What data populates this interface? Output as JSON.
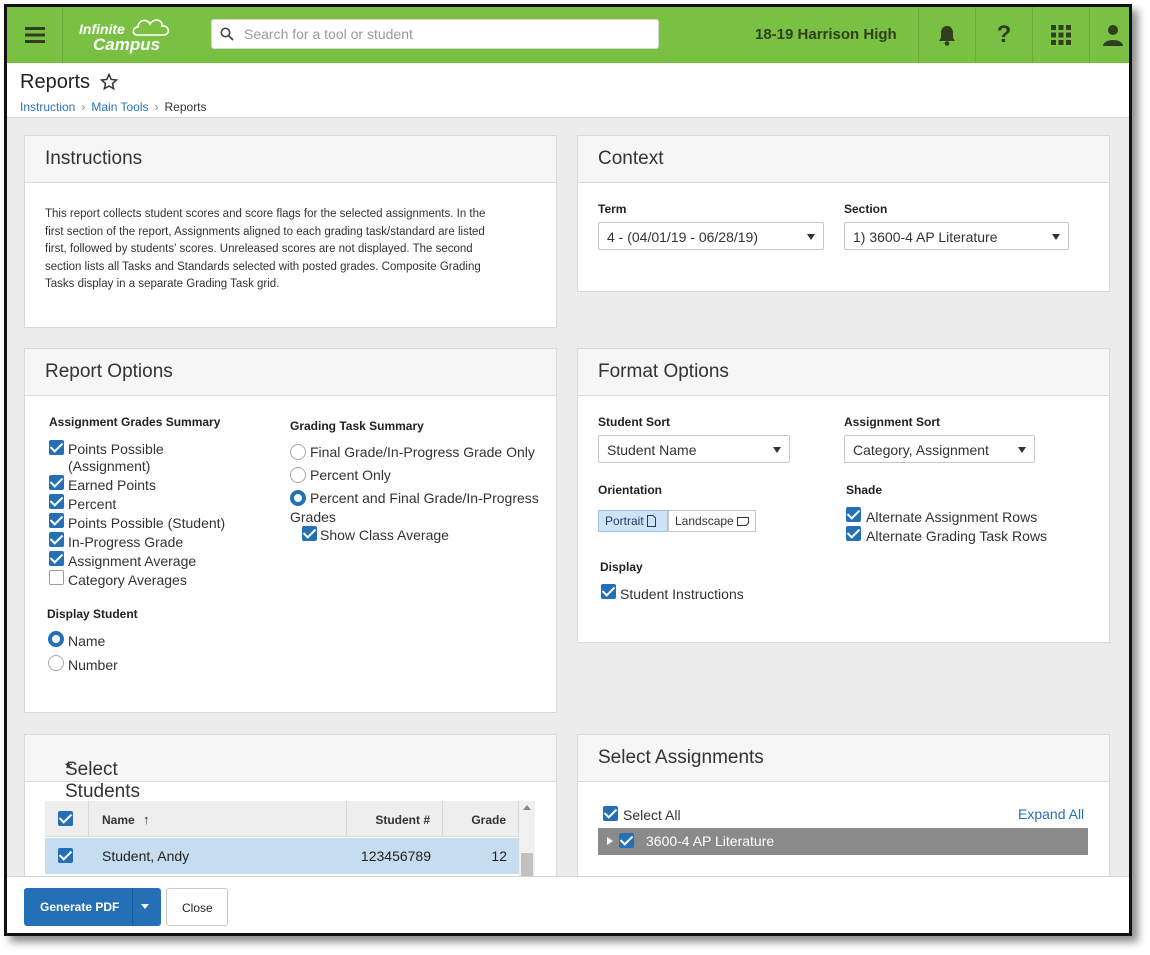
{
  "header": {
    "logo_line1": "Infinite",
    "logo_line2": "Campus",
    "search_placeholder": "Search for a tool or student",
    "school": "18-19 Harrison High",
    "icons": [
      "menu-icon",
      "bell-icon",
      "help-icon",
      "apps-grid-icon",
      "user-icon"
    ]
  },
  "page": {
    "title": "Reports",
    "breadcrumbs": [
      "Instruction",
      "Main Tools",
      "Reports"
    ]
  },
  "instructions": {
    "title": "Instructions",
    "text": "This report collects student scores and score flags for the selected assignments. In the first section of the report, Assignments aligned to each grading task/standard are listed first, followed by students' scores. Unreleased scores are not displayed. The second section lists all Tasks and Standards selected with posted grades. Composite Grading Tasks display in a separate Grading Task grid."
  },
  "context": {
    "title": "Context",
    "term_label": "Term",
    "term_value": "4 - (04/01/19 - 06/28/19)",
    "section_label": "Section",
    "section_value": "1) 3600-4 AP Literature"
  },
  "report_options": {
    "title": "Report Options",
    "ags_label": "Assignment Grades Summary",
    "ags_items": [
      {
        "label": "Points Possible (Assignment)",
        "checked": true
      },
      {
        "label": "Earned Points",
        "checked": true
      },
      {
        "label": "Percent",
        "checked": true
      },
      {
        "label": "Points Possible (Student)",
        "checked": true
      },
      {
        "label": "In-Progress Grade",
        "checked": true
      },
      {
        "label": "Assignment Average",
        "checked": true
      },
      {
        "label": "Category Averages",
        "checked": false
      }
    ],
    "ags_pp_line1": "Points Possible",
    "ags_pp_line2": "(Assignment)",
    "gts_label": "Grading Task Summary",
    "gts_items": [
      {
        "label": "Final Grade/In-Progress Grade Only",
        "selected": false
      },
      {
        "label": "Percent Only",
        "selected": false
      },
      {
        "label": "Percent and Final Grade/In-Progress Grades",
        "selected": true
      }
    ],
    "gts_pfg_line1": "Percent and Final Grade/In-Progress",
    "gts_pfg_line2": "Grades",
    "show_class_average": "Show Class Average",
    "display_student_label": "Display Student",
    "display_student": [
      {
        "label": "Name",
        "selected": true
      },
      {
        "label": "Number",
        "selected": false
      }
    ]
  },
  "format_options": {
    "title": "Format Options",
    "student_sort_label": "Student Sort",
    "student_sort_value": "Student Name",
    "assignment_sort_label": "Assignment Sort",
    "assignment_sort_value": "Category, Assignment",
    "orientation_label": "Orientation",
    "orientation_portrait": "Portrait",
    "orientation_landscape": "Landscape",
    "shade_label": "Shade",
    "shade_items": [
      "Alternate Assignment Rows",
      "Alternate Grading Task Rows"
    ],
    "display_label": "Display",
    "display_items": [
      "Student Instructions"
    ]
  },
  "select_students": {
    "title": "Select Students",
    "required_mark": "*",
    "columns": [
      "Name",
      "Student #",
      "Grade"
    ],
    "sort_arrow": "↑",
    "rows": [
      {
        "name": "Student, Andy",
        "number": "123456789",
        "grade": "12",
        "checked": true
      }
    ]
  },
  "select_assignments": {
    "title": "Select Assignments",
    "select_all": "Select All",
    "expand_all": "Expand All",
    "tree": [
      {
        "label": "3600-4 AP Literature",
        "checked": true
      }
    ]
  },
  "footer": {
    "generate": "Generate PDF",
    "close": "Close"
  },
  "colors": {
    "brand_green": "#7ac143",
    "primary_blue": "#2470b7",
    "selected_row": "#c6dcef"
  }
}
